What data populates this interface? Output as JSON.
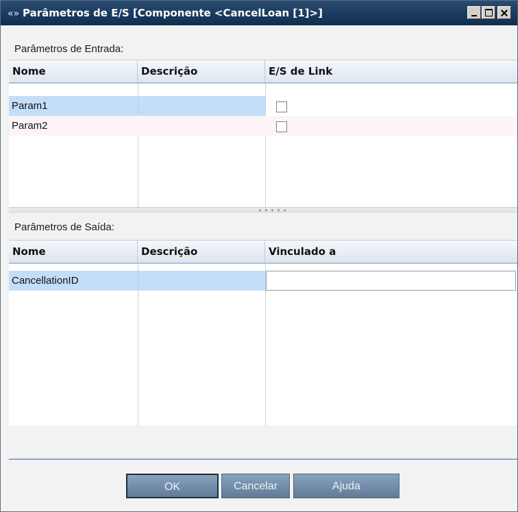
{
  "window": {
    "title": "Parâmetros de E/S [Componente <CancelLoan [1]>]",
    "title_icon": "«»"
  },
  "input_section": {
    "label": "Parâmetros de Entrada:",
    "columns": [
      "Nome",
      "Descrição",
      "E/S de Link"
    ],
    "rows": [
      {
        "name": "Param1",
        "description": "",
        "link": false
      },
      {
        "name": "Param2",
        "description": "",
        "link": false
      }
    ]
  },
  "output_section": {
    "label": "Parâmetros de Saída:",
    "columns": [
      "Nome",
      "Descrição",
      "Vinculado a"
    ],
    "rows": [
      {
        "name": "CancellationID",
        "description": "",
        "bound_to": ""
      }
    ]
  },
  "buttons": {
    "ok": "OK",
    "cancel": "Cancelar",
    "help": "Ajuda"
  },
  "icons": {
    "title_icon": "io-parameters-icon",
    "splitter": "splitter-grip-icon"
  }
}
